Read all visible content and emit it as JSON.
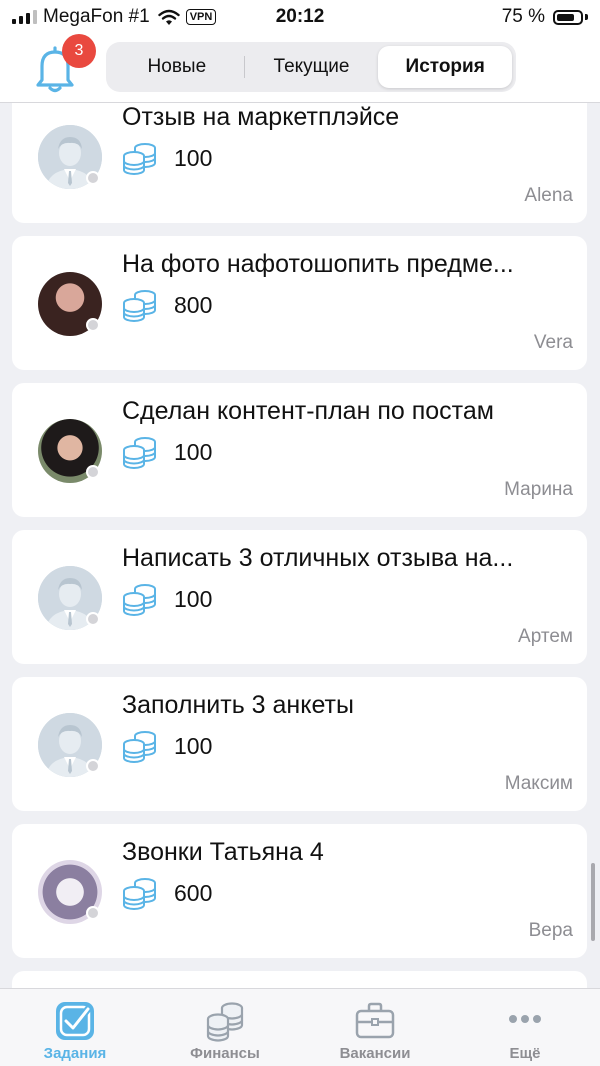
{
  "status_bar": {
    "carrier": "MegaFon #1",
    "vpn": "VPN",
    "time": "20:12",
    "battery_percent": "75 %",
    "battery_level": 0.75
  },
  "header": {
    "notifications_count": "3",
    "segments": [
      {
        "label": "Новые",
        "active": false
      },
      {
        "label": "Текущие",
        "active": false
      },
      {
        "label": "История",
        "active": true
      }
    ]
  },
  "tasks": [
    {
      "title": "Отзыв на маркетплэйсе",
      "amount": "100",
      "author": "Alena",
      "avatar": "default"
    },
    {
      "title": "На фото нафотошопить предме...",
      "amount": "800",
      "author": "Vera",
      "avatar": "photo1"
    },
    {
      "title": "Сделан контент-план по постам",
      "amount": "100",
      "author": "Марина",
      "avatar": "photo2"
    },
    {
      "title": "Написать 3 отличных отзыва на...",
      "amount": "100",
      "author": "Артем",
      "avatar": "default"
    },
    {
      "title": "Заполнить 3 анкеты",
      "amount": "100",
      "author": "Максим",
      "avatar": "default"
    },
    {
      "title": "Звонки Татьяна 4",
      "amount": "600",
      "author": "Вера",
      "avatar": "photo3"
    }
  ],
  "tabbar": {
    "tabs": [
      {
        "label": "Задания",
        "icon": "tasks-icon",
        "active": true
      },
      {
        "label": "Финансы",
        "icon": "coins-icon",
        "active": false
      },
      {
        "label": "Вакансии",
        "icon": "briefcase-icon",
        "active": false
      },
      {
        "label": "Ещё",
        "icon": "more-icon",
        "active": false
      }
    ]
  },
  "colors": {
    "accent": "#5ab4e6",
    "badge": "#e9493f",
    "background": "#eff0f4",
    "inactive": "#8e8e93"
  }
}
